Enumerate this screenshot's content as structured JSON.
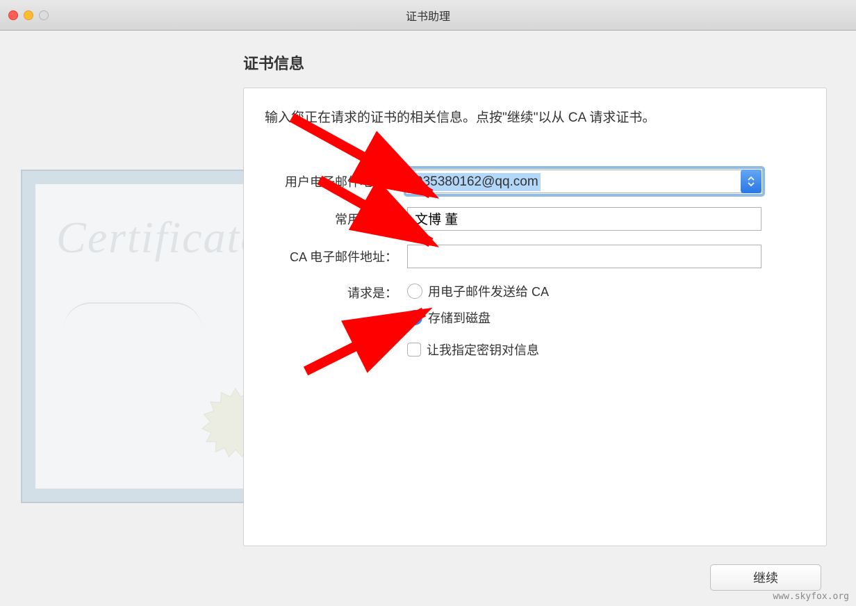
{
  "window": {
    "title": "证书助理"
  },
  "section": {
    "heading": "证书信息",
    "description": "输入您正在请求的证书的相关信息。点按\"继续\"以从 CA 请求证书。"
  },
  "form": {
    "email_label": "用户电子邮件地址：",
    "email_value": "935380162@qq.com",
    "common_name_label": "常用名称：",
    "common_name_value": "文博 董",
    "ca_email_label": "CA 电子邮件地址：",
    "ca_email_value": "",
    "request_is_label": "请求是：",
    "option_email_ca": "用电子邮件发送给 CA",
    "option_save_disk": "存储到磁盘",
    "option_specify_keypair": "让我指定密钥对信息"
  },
  "buttons": {
    "continue": "继续"
  },
  "watermark": "www.skyfox.org",
  "certificate_graphic": {
    "title": "Certificate"
  }
}
